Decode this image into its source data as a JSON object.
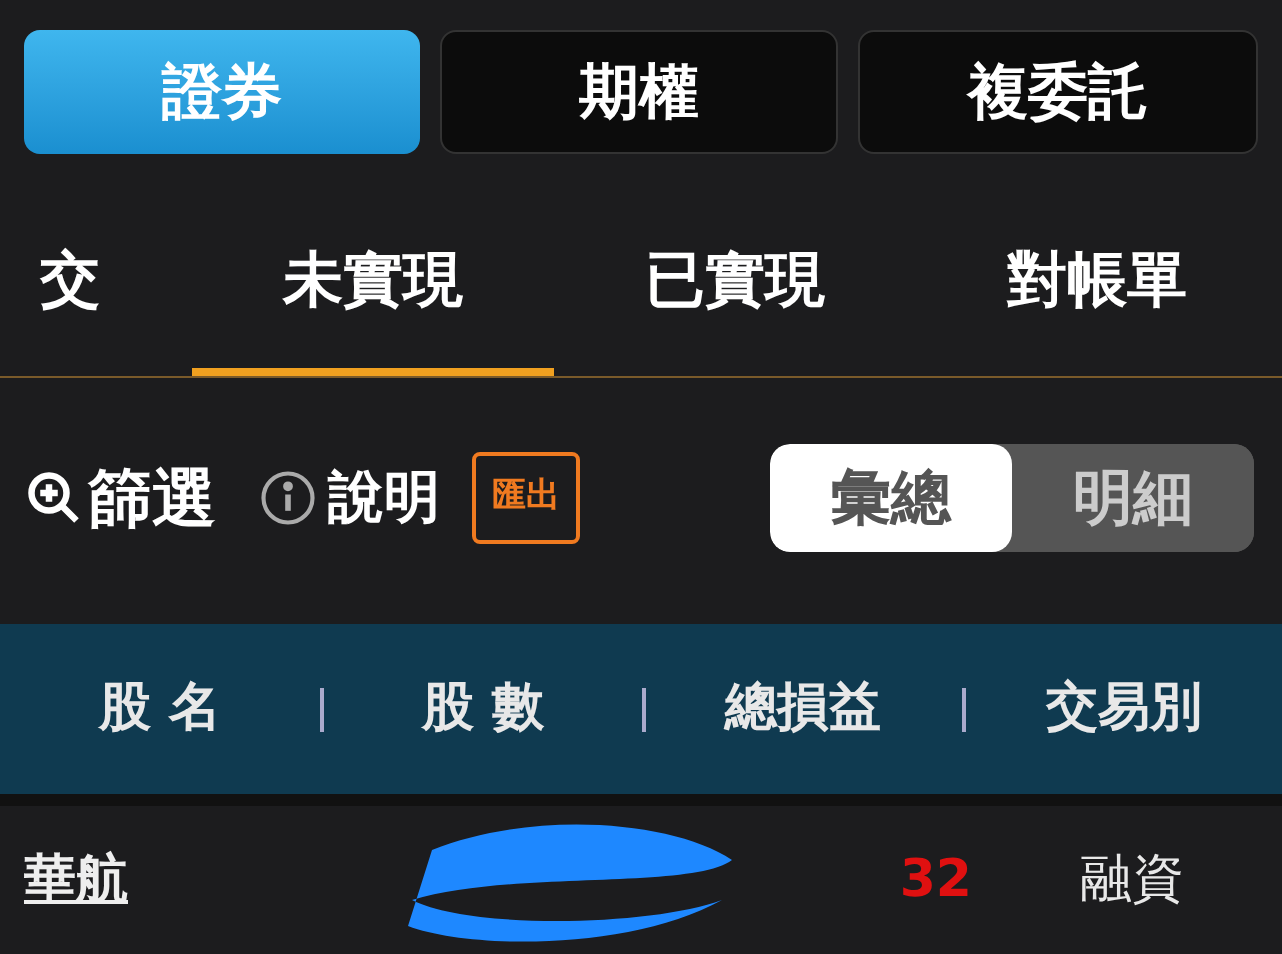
{
  "markets": [
    {
      "label": "證券",
      "selected": true
    },
    {
      "label": "期權",
      "selected": false
    },
    {
      "label": "複委託",
      "selected": false
    }
  ],
  "tabs": [
    {
      "label": "交",
      "selected": false
    },
    {
      "label": "未實現",
      "selected": true
    },
    {
      "label": "已實現",
      "selected": false
    },
    {
      "label": "對帳單",
      "selected": false
    }
  ],
  "toolbar": {
    "filter": "篩選",
    "help": "說明",
    "export": "匯出"
  },
  "view_toggle": [
    {
      "label": "彙總",
      "selected": true
    },
    {
      "label": "明細",
      "selected": false
    }
  ],
  "table": {
    "columns": [
      "股 名",
      "股 數",
      "總損益",
      "交易別"
    ],
    "rows": [
      {
        "name": "華航",
        "profit": "32",
        "trade_type": "融資"
      }
    ]
  }
}
